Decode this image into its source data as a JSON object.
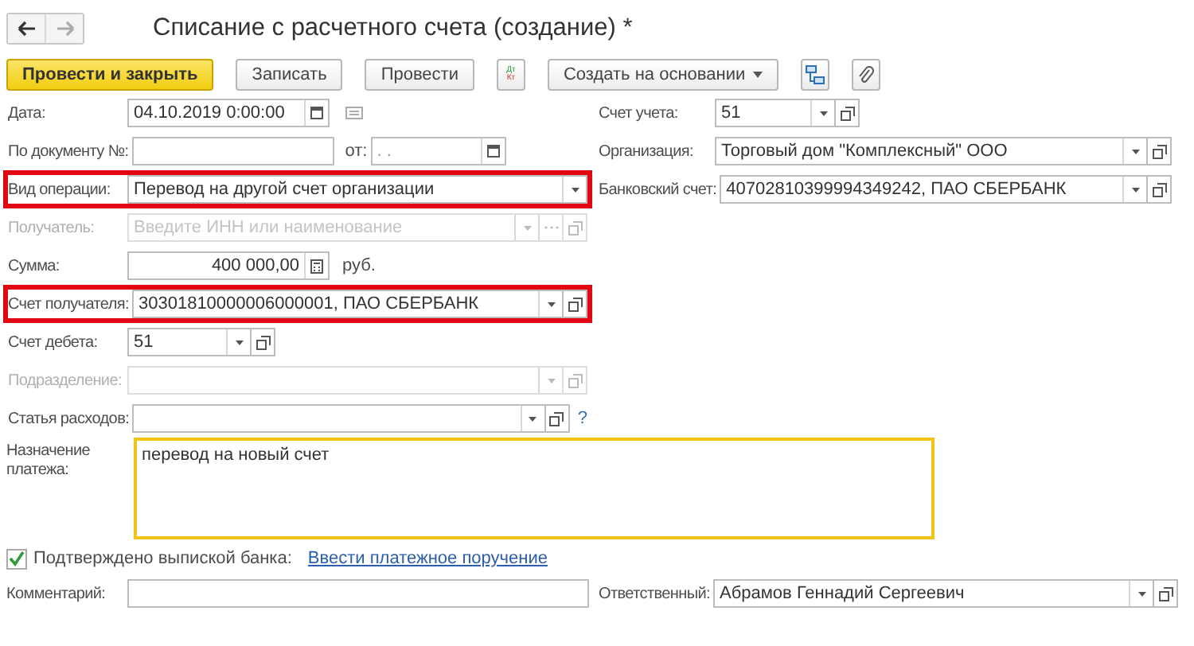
{
  "title": "Списание с расчетного счета (создание) *",
  "toolbar": [
    {
      "kind": "default",
      "label": "Провести и закрыть"
    },
    {
      "kind": "button",
      "label": "Записать"
    },
    {
      "kind": "button",
      "label": "Провести"
    },
    {
      "kind": "dtkt",
      "label": "Дт",
      "sublabel": "Кт"
    },
    {
      "kind": "menu",
      "label": "Создать на основании"
    },
    {
      "kind": "structure"
    },
    {
      "kind": "clip"
    }
  ],
  "left_fields": [
    {
      "label": "Дата:",
      "kind": "date",
      "value": "04.10.2019  0:00:00",
      "disabled": false,
      "highlighted": false
    },
    {
      "label": "По документу №:",
      "kind": "docnum",
      "date_label": "от:",
      "date_value": " .  .",
      "disabled": false,
      "highlighted": false
    },
    {
      "label": "Вид операции:",
      "kind": "enum",
      "value": "Перевод на другой счет организации",
      "disabled": false,
      "highlighted": true
    },
    {
      "label": "Получатель:",
      "kind": "picker",
      "placeholder": "Введите ИНН или наименование",
      "disabled": true,
      "highlighted": false
    },
    {
      "label": "Сумма:",
      "kind": "amount",
      "value": "400 000,00",
      "unit": "руб.",
      "disabled": false,
      "highlighted": false
    },
    {
      "label": "Счет получателя:",
      "kind": "ref",
      "value": "30301810000006000001, ПАО СБЕРБАНК",
      "disabled": false,
      "highlighted": true
    },
    {
      "label": "Счет дебета:",
      "kind": "short_ref",
      "value": "51",
      "disabled": false,
      "highlighted": false
    },
    {
      "label": "Подразделение:",
      "kind": "ref",
      "disabled": true,
      "highlighted": false
    },
    {
      "label": "Статья расходов:",
      "kind": "ref",
      "help": "?",
      "disabled": false,
      "highlighted": false
    }
  ],
  "right_fields": [
    {
      "label": "Счет учета:",
      "kind": "short_ref",
      "value": "51"
    },
    {
      "label": "Организация:",
      "kind": "ref",
      "value": "Торговый дом \"Комплексный\" ООО"
    },
    {
      "label": "Банковский счет:",
      "kind": "ref",
      "value": "40702810399994349242, ПАО СБЕРБАНК"
    }
  ],
  "purpose": {
    "label": "Назначение платежа:",
    "value": "перевод на новый счет",
    "focused": true
  },
  "confirmed": {
    "label": "Подтверждено выпиской банка:",
    "checked": true,
    "link": "Ввести платежное поручение"
  },
  "comment": {
    "label": "Комментарий:"
  },
  "responsible": {
    "label": "Ответственный:",
    "value": "Абрамов Геннадий Сергеевич"
  }
}
